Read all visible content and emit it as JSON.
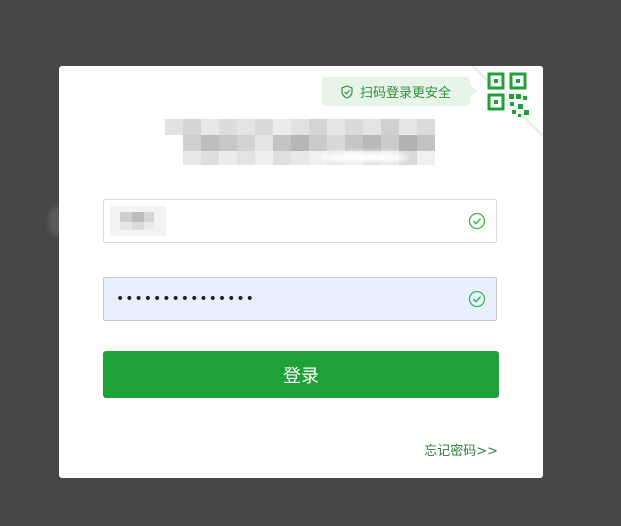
{
  "login": {
    "qr_tip": "扫码登录更安全",
    "password_masked": "•••••••••••••••",
    "login_button": "登录",
    "forgot_password": "忘记密码>>"
  },
  "colors": {
    "accent": "#1fa13a",
    "tip_background": "#e6f5e8",
    "backdrop": "#474747",
    "check": "#3cb34a"
  },
  "icons": {
    "tip": "shield-check-icon",
    "corner": "qr-code-icon",
    "username_status": "check-circle-icon",
    "password_status": "check-circle-icon"
  }
}
